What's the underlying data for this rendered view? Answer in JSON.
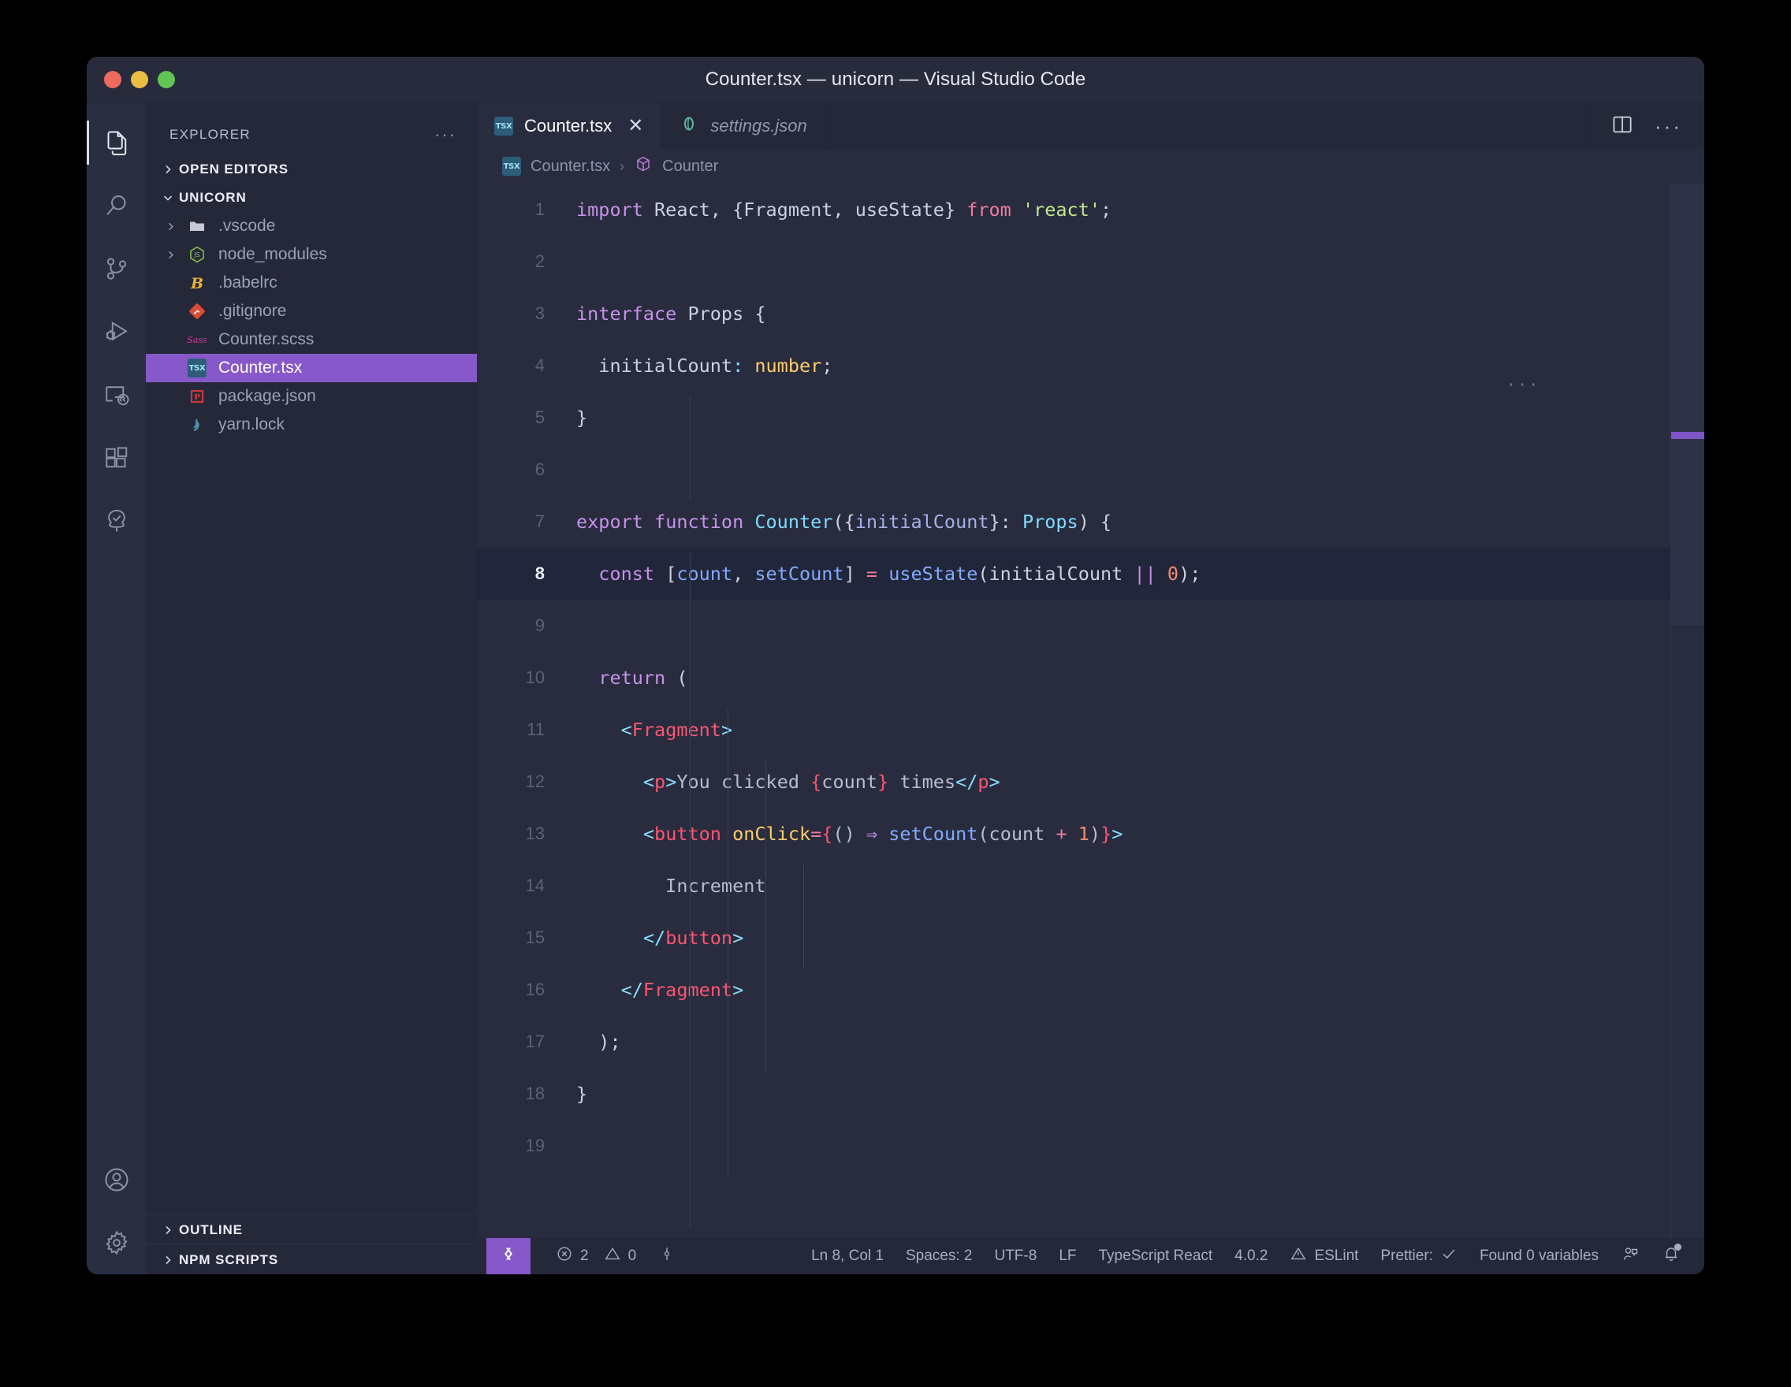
{
  "window": {
    "title": "Counter.tsx — unicorn — Visual Studio Code",
    "traffic": {
      "close": "close-button",
      "minimize": "minimize-button",
      "zoom": "zoom-button"
    }
  },
  "activity_bar": {
    "items": [
      {
        "name": "explorer",
        "icon": "files-icon",
        "active": true
      },
      {
        "name": "search",
        "icon": "search-icon",
        "active": false
      },
      {
        "name": "source-control",
        "icon": "source-control-icon",
        "active": false
      },
      {
        "name": "run-and-debug",
        "icon": "run-debug-icon",
        "active": false
      },
      {
        "name": "remote-explorer",
        "icon": "remote-explorer-icon",
        "active": false
      },
      {
        "name": "extensions",
        "icon": "extensions-icon",
        "active": false
      },
      {
        "name": "testing",
        "icon": "tree-check-icon",
        "active": false
      }
    ],
    "bottom_items": [
      {
        "name": "accounts",
        "icon": "account-icon"
      },
      {
        "name": "manage",
        "icon": "gear-icon"
      }
    ]
  },
  "sidebar": {
    "header": {
      "title": "EXPLORER",
      "more_label": "···"
    },
    "sections": [
      {
        "label": "OPEN EDITORS",
        "expanded": false,
        "chevron": "chevron-right-icon"
      },
      {
        "label": "UNICORN",
        "expanded": true,
        "chevron": "chevron-down-icon"
      }
    ],
    "tree": [
      {
        "label": ".vscode",
        "icon": "folder-icon",
        "twisty": "chevron-right-icon",
        "selected": false
      },
      {
        "label": "node_modules",
        "icon": "nodejs-icon",
        "twisty": "chevron-right-icon",
        "selected": false
      },
      {
        "label": ".babelrc",
        "icon": "babel-icon",
        "twisty": "",
        "selected": false
      },
      {
        "label": ".gitignore",
        "icon": "git-icon",
        "twisty": "",
        "selected": false
      },
      {
        "label": "Counter.scss",
        "icon": "sass-icon",
        "twisty": "",
        "selected": false
      },
      {
        "label": "Counter.tsx",
        "icon": "tsx-icon",
        "twisty": "",
        "selected": true
      },
      {
        "label": "package.json",
        "icon": "npm-icon",
        "twisty": "",
        "selected": false
      },
      {
        "label": "yarn.lock",
        "icon": "yarn-icon",
        "twisty": "",
        "selected": false
      }
    ],
    "bottom_sections": [
      {
        "label": "OUTLINE",
        "chevron": "chevron-right-icon"
      },
      {
        "label": "NPM SCRIPTS",
        "chevron": "chevron-right-icon"
      }
    ]
  },
  "editor": {
    "tabs": [
      {
        "label": "Counter.tsx",
        "icon": "tsx-icon",
        "active": true,
        "preview": false,
        "close": "✕"
      },
      {
        "label": "settings.json",
        "icon": "json-icon",
        "active": false,
        "preview": true,
        "close": ""
      }
    ],
    "actions": [
      {
        "name": "split-editor-button",
        "icon": "split-editor-icon"
      },
      {
        "name": "more-actions-button",
        "icon": "ellipsis-icon",
        "label": "···"
      }
    ],
    "breadcrumbs": [
      {
        "label": "Counter.tsx",
        "icon": "tsx-icon"
      },
      {
        "label": "Counter",
        "icon": "symbol-class-icon"
      }
    ],
    "inlay_hint": "···",
    "lines": [
      {
        "n": "1",
        "active": false,
        "tokens": [
          {
            "t": "import",
            "c": "t-kw"
          },
          {
            "t": " React, {Fragment, useState} ",
            "c": "t-id"
          },
          {
            "t": "from",
            "c": "t-pink"
          },
          {
            "t": " ",
            "c": "t-id"
          },
          {
            "t": "'react'",
            "c": "t-str"
          },
          {
            "t": ";",
            "c": "t-id"
          }
        ]
      },
      {
        "n": "2",
        "active": false,
        "tokens": []
      },
      {
        "n": "3",
        "active": false,
        "tokens": [
          {
            "t": "interface",
            "c": "t-kw"
          },
          {
            "t": " Props {",
            "c": "t-id"
          }
        ]
      },
      {
        "n": "4",
        "active": false,
        "tokens": [
          {
            "t": "  initialCount",
            "c": "t-id"
          },
          {
            "t": ":",
            "c": "t-op"
          },
          {
            "t": " ",
            "c": "t-id"
          },
          {
            "t": "number",
            "c": "t-numT"
          },
          {
            "t": ";",
            "c": "t-id"
          }
        ]
      },
      {
        "n": "5",
        "active": false,
        "tokens": [
          {
            "t": "}",
            "c": "t-id"
          }
        ]
      },
      {
        "n": "6",
        "active": false,
        "tokens": []
      },
      {
        "n": "7",
        "active": false,
        "tokens": [
          {
            "t": "export",
            "c": "t-kw"
          },
          {
            "t": " ",
            "c": "t-id"
          },
          {
            "t": "function",
            "c": "t-kw"
          },
          {
            "t": " ",
            "c": "t-id"
          },
          {
            "t": "Counter",
            "c": "t-type"
          },
          {
            "t": "({",
            "c": "t-id"
          },
          {
            "t": "initialCount",
            "c": "t-param"
          },
          {
            "t": "}: ",
            "c": "t-id"
          },
          {
            "t": "Props",
            "c": "t-type"
          },
          {
            "t": ") {",
            "c": "t-id"
          }
        ]
      },
      {
        "n": "8",
        "active": true,
        "tokens": [
          {
            "t": "  ",
            "c": "t-id"
          },
          {
            "t": "const",
            "c": "t-kw"
          },
          {
            "t": " [",
            "c": "t-id"
          },
          {
            "t": "count",
            "c": "t-var"
          },
          {
            "t": ", ",
            "c": "t-id"
          },
          {
            "t": "setCount",
            "c": "t-var"
          },
          {
            "t": "] ",
            "c": "t-id"
          },
          {
            "t": "=",
            "c": "t-pink"
          },
          {
            "t": " ",
            "c": "t-id"
          },
          {
            "t": "useState",
            "c": "t-var"
          },
          {
            "t": "(initialCount ",
            "c": "t-id"
          },
          {
            "t": "||",
            "c": "t-kw"
          },
          {
            "t": " ",
            "c": "t-id"
          },
          {
            "t": "0",
            "c": "t-num"
          },
          {
            "t": ");",
            "c": "t-id"
          }
        ]
      },
      {
        "n": "9",
        "active": false,
        "tokens": []
      },
      {
        "n": "10",
        "active": false,
        "tokens": [
          {
            "t": "  ",
            "c": "t-id"
          },
          {
            "t": "return",
            "c": "t-kw"
          },
          {
            "t": " (",
            "c": "t-id"
          }
        ]
      },
      {
        "n": "11",
        "active": false,
        "tokens": [
          {
            "t": "    ",
            "c": "t-id"
          },
          {
            "t": "<",
            "c": "t-op"
          },
          {
            "t": "Fragment",
            "c": "t-tag"
          },
          {
            "t": ">",
            "c": "t-op"
          }
        ]
      },
      {
        "n": "12",
        "active": false,
        "tokens": [
          {
            "t": "      ",
            "c": "t-id"
          },
          {
            "t": "<",
            "c": "t-op"
          },
          {
            "t": "p",
            "c": "t-tag"
          },
          {
            "t": ">",
            "c": "t-op"
          },
          {
            "t": "You clicked ",
            "c": "t-txt"
          },
          {
            "t": "{",
            "c": "t-brace"
          },
          {
            "t": "count",
            "c": "t-txt"
          },
          {
            "t": "}",
            "c": "t-brace"
          },
          {
            "t": " times",
            "c": "t-txt"
          },
          {
            "t": "</",
            "c": "t-op"
          },
          {
            "t": "p",
            "c": "t-tag"
          },
          {
            "t": ">",
            "c": "t-op"
          }
        ]
      },
      {
        "n": "13",
        "active": false,
        "tokens": [
          {
            "t": "      ",
            "c": "t-id"
          },
          {
            "t": "<",
            "c": "t-op"
          },
          {
            "t": "button",
            "c": "t-tag"
          },
          {
            "t": " ",
            "c": "t-id"
          },
          {
            "t": "onClick",
            "c": "t-attr"
          },
          {
            "t": "=",
            "c": "t-pink"
          },
          {
            "t": "{",
            "c": "t-brace"
          },
          {
            "t": "()",
            "c": "t-txt"
          },
          {
            "t": " ",
            "c": "t-id"
          },
          {
            "t": "⇒",
            "c": "t-kw"
          },
          {
            "t": " ",
            "c": "t-id"
          },
          {
            "t": "setCount",
            "c": "t-var"
          },
          {
            "t": "(count ",
            "c": "t-txt"
          },
          {
            "t": "+",
            "c": "t-pink"
          },
          {
            "t": " ",
            "c": "t-id"
          },
          {
            "t": "1",
            "c": "t-num"
          },
          {
            "t": ")",
            "c": "t-txt"
          },
          {
            "t": "}",
            "c": "t-brace"
          },
          {
            "t": ">",
            "c": "t-op"
          }
        ]
      },
      {
        "n": "14",
        "active": false,
        "tokens": [
          {
            "t": "        Increment",
            "c": "t-txt"
          }
        ]
      },
      {
        "n": "15",
        "active": false,
        "tokens": [
          {
            "t": "      ",
            "c": "t-id"
          },
          {
            "t": "</",
            "c": "t-op"
          },
          {
            "t": "button",
            "c": "t-tag"
          },
          {
            "t": ">",
            "c": "t-op"
          }
        ]
      },
      {
        "n": "16",
        "active": false,
        "tokens": [
          {
            "t": "    ",
            "c": "t-id"
          },
          {
            "t": "</",
            "c": "t-op"
          },
          {
            "t": "Fragment",
            "c": "t-tag"
          },
          {
            "t": ">",
            "c": "t-op"
          }
        ]
      },
      {
        "n": "17",
        "active": false,
        "tokens": [
          {
            "t": "  );",
            "c": "t-id"
          }
        ]
      },
      {
        "n": "18",
        "active": false,
        "tokens": [
          {
            "t": "}",
            "c": "t-id"
          }
        ]
      },
      {
        "n": "19",
        "active": false,
        "tokens": []
      }
    ]
  },
  "status_bar": {
    "remote": {
      "icon": "remote-window-icon",
      "label": ""
    },
    "left": [
      {
        "name": "problems-errors",
        "icon": "error-icon",
        "label": "2"
      },
      {
        "name": "problems-warnings",
        "icon": "warning-icon",
        "label": "0"
      },
      {
        "name": "ports",
        "icon": "ports-icon",
        "label": ""
      }
    ],
    "right": [
      {
        "name": "cursor-position",
        "icon": "",
        "label": "Ln 8, Col 1"
      },
      {
        "name": "indentation",
        "icon": "",
        "label": "Spaces: 2"
      },
      {
        "name": "encoding",
        "icon": "",
        "label": "UTF-8"
      },
      {
        "name": "eol",
        "icon": "",
        "label": "LF"
      },
      {
        "name": "language-mode",
        "icon": "",
        "label": "TypeScript React"
      },
      {
        "name": "typescript-version",
        "icon": "",
        "label": "4.0.2"
      },
      {
        "name": "eslint",
        "icon": "warning-icon",
        "label": "ESLint"
      },
      {
        "name": "prettier",
        "icon": "check-icon",
        "label": "Prettier:"
      },
      {
        "name": "found-variables",
        "icon": "",
        "label": "Found 0 variables"
      },
      {
        "name": "feedback",
        "icon": "feedback-person-icon",
        "label": ""
      },
      {
        "name": "notifications",
        "icon": "bell-icon",
        "label": ""
      }
    ]
  },
  "colors": {
    "accent_purple": "#8758c9",
    "editor_bg": "#282c3e",
    "sidebar_bg": "#252839",
    "activity_bg": "#2a2e41",
    "active_line_bg": "#22263a",
    "traffic_red": "#ec6a5e",
    "traffic_yellow": "#e8bf42",
    "traffic_green": "#62c454"
  }
}
